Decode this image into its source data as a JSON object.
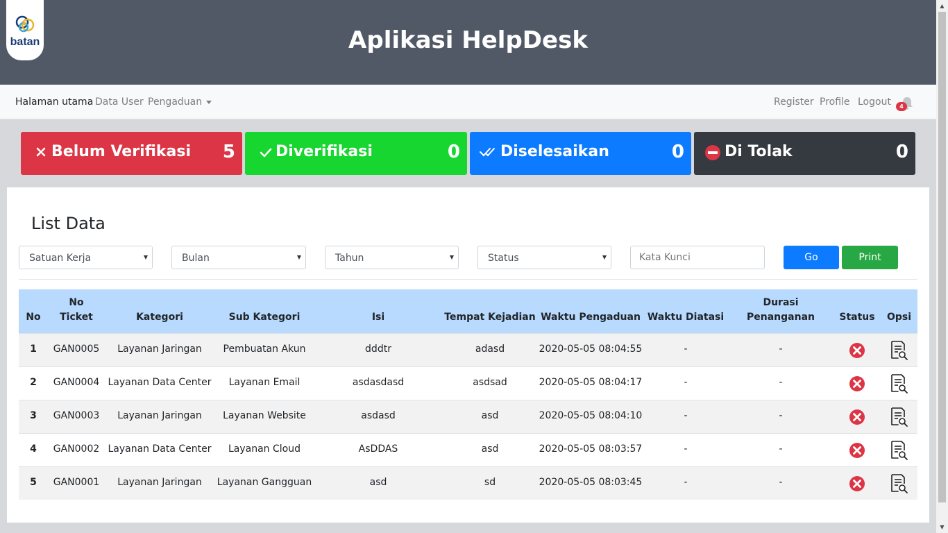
{
  "header": {
    "logo_text": "batan",
    "title": "Aplikasi HelpDesk"
  },
  "nav": {
    "left": [
      {
        "label": "Halaman utama"
      },
      {
        "label": "Data User"
      },
      {
        "label": "Pengaduan"
      }
    ],
    "right": [
      {
        "label": "Register"
      },
      {
        "label": "Profile"
      },
      {
        "label": "Logout"
      }
    ],
    "notification_count": "4"
  },
  "stats": [
    {
      "label": "Belum Verifikasi",
      "count": "5",
      "color": "#dc3545",
      "icon": "close-icon"
    },
    {
      "label": "Diverifikasi",
      "count": "0",
      "color": "#17d62f",
      "icon": "check-icon"
    },
    {
      "label": "Diselesaikan",
      "count": "0",
      "color": "#0d7bff",
      "icon": "double-check-icon"
    },
    {
      "label": "Di Tolak",
      "count": "0",
      "color": "#343a40",
      "icon": "no-entry-icon"
    }
  ],
  "main": {
    "title": "List Data",
    "filters": [
      {
        "label": "Satuan Kerja"
      },
      {
        "label": "Bulan"
      },
      {
        "label": "Tahun"
      },
      {
        "label": "Status"
      }
    ],
    "search_placeholder": "Kata Kunci",
    "go_label": "Go",
    "print_label": "Print",
    "go_color": "#0d7bff",
    "print_color": "#28a745"
  },
  "table": {
    "headers": {
      "no": "No",
      "no_ticket_1": "No",
      "no_ticket_2": "Ticket",
      "kategori": "Kategori",
      "sub_kategori": "Sub Kategori",
      "isi": "Isi",
      "tempat": "Tempat Kejadian",
      "waktu_pengaduan": "Waktu Pengaduan",
      "waktu_diatasi": "Waktu Diatasi",
      "durasi": "Durasi Penanganan",
      "status": "Status",
      "opsi": "Opsi"
    },
    "rows": [
      {
        "no": "1",
        "ticket": "GAN0005",
        "kategori": "Layanan Jaringan",
        "sub": "Pembuatan Akun",
        "isi": "dddtr",
        "tempat": "adasd",
        "waktu": "2020-05-05 08:04:55",
        "diatasi": "-",
        "durasi": "-",
        "status": "x-circle-icon"
      },
      {
        "no": "2",
        "ticket": "GAN0004",
        "kategori": "Layanan Data Center",
        "sub": "Layanan Email",
        "isi": "asdasdasd",
        "tempat": "asdsad",
        "waktu": "2020-05-05 08:04:17",
        "diatasi": "-",
        "durasi": "-",
        "status": "x-circle-icon"
      },
      {
        "no": "3",
        "ticket": "GAN0003",
        "kategori": "Layanan Jaringan",
        "sub": "Layanan Website",
        "isi": "asdasd",
        "tempat": "asd",
        "waktu": "2020-05-05 08:04:10",
        "diatasi": "-",
        "durasi": "-",
        "status": "x-circle-icon"
      },
      {
        "no": "4",
        "ticket": "GAN0002",
        "kategori": "Layanan Data Center",
        "sub": "Layanan Cloud",
        "isi": "AsDDAS",
        "tempat": "asd",
        "waktu": "2020-05-05 08:03:57",
        "diatasi": "-",
        "durasi": "-",
        "status": "x-circle-icon"
      },
      {
        "no": "5",
        "ticket": "GAN0001",
        "kategori": "Layanan Jaringan",
        "sub": "Layanan Gangguan",
        "isi": "asd",
        "tempat": "sd",
        "waktu": "2020-05-05 08:03:45",
        "diatasi": "-",
        "durasi": "-",
        "status": "x-circle-icon"
      }
    ]
  }
}
